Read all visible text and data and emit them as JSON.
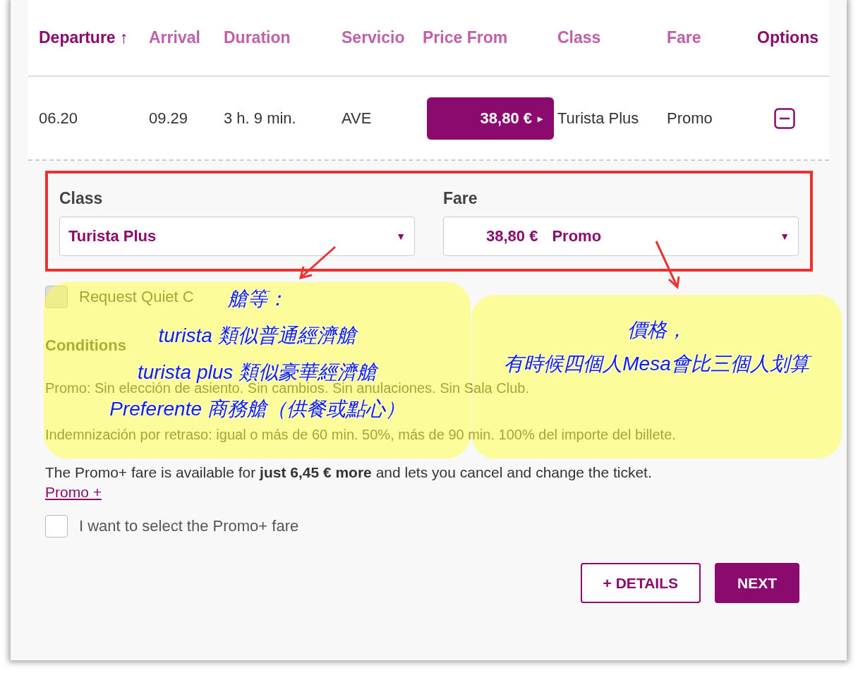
{
  "columns": [
    {
      "label": "Departure ↑",
      "kind": "sorted"
    },
    {
      "label": "Arrival",
      "kind": "sortable"
    },
    {
      "label": "Duration",
      "kind": "sortable"
    },
    {
      "label": "Servicio",
      "kind": "sortable"
    },
    {
      "label": "Price From",
      "kind": "sortable"
    },
    {
      "label": "Class",
      "kind": "sortable"
    },
    {
      "label": "Fare",
      "kind": "sortable"
    },
    {
      "label": "Options",
      "kind": "plain"
    }
  ],
  "row": {
    "departure": "06.20",
    "arrival": "09.29",
    "duration": "3 h. 9 min.",
    "service": "AVE",
    "price": "38,80 €",
    "price_arrow": "▸",
    "class": "Turista Plus",
    "fare": "Promo",
    "expanded": true
  },
  "details": {
    "class": {
      "label": "Class",
      "value": "Turista Plus",
      "caret": "▼"
    },
    "fare": {
      "label": "Fare",
      "price": "38,80 €",
      "value": "Promo",
      "caret": "▼"
    },
    "quiet_coach": {
      "label": "Request Quiet C",
      "checked": false
    },
    "conditions": {
      "title": "Conditions",
      "lines": [
        "Promo:   Sin elección de asiento.  Sin cambios.  Sin anulaciones.  Sin Sala Club.",
        "Indemnización por retraso: igual o más de 60 min. 50%, más de 90 min. 100% del importe del billete."
      ]
    },
    "upsell": "The Promo+ fare is available for **just 6,45 € more** and lets you cancel and change the ticket.",
    "upsell_link": "Promo +",
    "promo_plus": {
      "label": "I want to select the Promo+ fare",
      "checked": false
    },
    "buttons": [
      {
        "label": "+ DETAILS",
        "kind": "secondary"
      },
      {
        "label": "NEXT",
        "kind": "primary"
      }
    ]
  },
  "annotations": [
    {
      "lines": [
        "艙等：",
        "turista 類似普通經濟艙",
        "turista plus 類似豪華經濟艙",
        "Preferente 商務艙（供餐或點心）"
      ]
    },
    {
      "lines": [
        "價格，",
        "有時候四個人Mesa會比三個人划算"
      ]
    }
  ]
}
